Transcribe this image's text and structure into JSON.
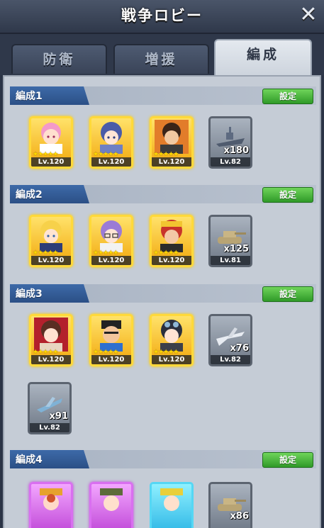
{
  "header": {
    "title": "戦争ロビー",
    "close_icon": "close-icon"
  },
  "tabs": [
    {
      "label": "防衛",
      "active": false
    },
    {
      "label": "増援",
      "active": false
    },
    {
      "label": "編成",
      "active": true
    }
  ],
  "formations": [
    {
      "label": "編成1",
      "set_label": "設定",
      "units": [
        {
          "type": "hero",
          "rarity": "gold",
          "stars": "★★★★★",
          "level": "Lv.120",
          "icon": "pink-hair-girl-portrait-icon"
        },
        {
          "type": "hero",
          "rarity": "gold",
          "stars": "★★★★★",
          "level": "Lv.120",
          "icon": "blue-hair-girl-portrait-icon"
        },
        {
          "type": "hero",
          "rarity": "gold",
          "stars": "★★★★★",
          "level": "Lv.120",
          "icon": "dark-hair-boy-portrait-icon"
        },
        {
          "type": "unit",
          "level": "Lv.82",
          "qty": "x180",
          "icon": "battleship-icon"
        }
      ]
    },
    {
      "label": "編成2",
      "set_label": "設定",
      "units": [
        {
          "type": "hero",
          "rarity": "gold",
          "stars": "★★★★★",
          "level": "Lv.120",
          "icon": "blonde-girl-portrait-icon"
        },
        {
          "type": "hero",
          "rarity": "gold",
          "stars": "★★★★★",
          "level": "Lv.120",
          "icon": "purple-hair-girl-glasses-portrait-icon"
        },
        {
          "type": "hero",
          "rarity": "gold",
          "stars": "★★★★★",
          "level": "Lv.120",
          "icon": "red-hair-boy-portrait-icon"
        },
        {
          "type": "unit",
          "level": "Lv.81",
          "qty": "x125",
          "icon": "tank-icon"
        }
      ]
    },
    {
      "label": "編成3",
      "set_label": "設定",
      "units": [
        {
          "type": "hero",
          "rarity": "gold",
          "stars": "★★★★★",
          "level": "Lv.120",
          "icon": "brown-hair-girl-portrait-icon"
        },
        {
          "type": "hero",
          "rarity": "gold",
          "stars": "★★★★★",
          "level": "Lv.120",
          "icon": "cartoon-man-portrait-icon"
        },
        {
          "type": "hero",
          "rarity": "gold",
          "stars": "★★★★★",
          "level": "Lv.120",
          "icon": "goggles-girl-portrait-icon"
        },
        {
          "type": "unit",
          "level": "Lv.82",
          "qty": "x76",
          "icon": "fighter-jet-icon"
        },
        {
          "type": "unit",
          "level": "Lv.82",
          "qty": "x91",
          "icon": "aircraft-icon"
        }
      ]
    },
    {
      "label": "編成4",
      "set_label": "設定",
      "units": [
        {
          "type": "hero",
          "rarity": "purple",
          "icon": "hat-girl-portrait-icon"
        },
        {
          "type": "hero",
          "rarity": "purple",
          "icon": "camo-hat-girl-portrait-icon"
        },
        {
          "type": "hero",
          "rarity": "cyan",
          "icon": "yellow-hat-girl-portrait-icon"
        },
        {
          "type": "unit",
          "qty": "x86",
          "icon": "tank-icon"
        }
      ]
    }
  ]
}
